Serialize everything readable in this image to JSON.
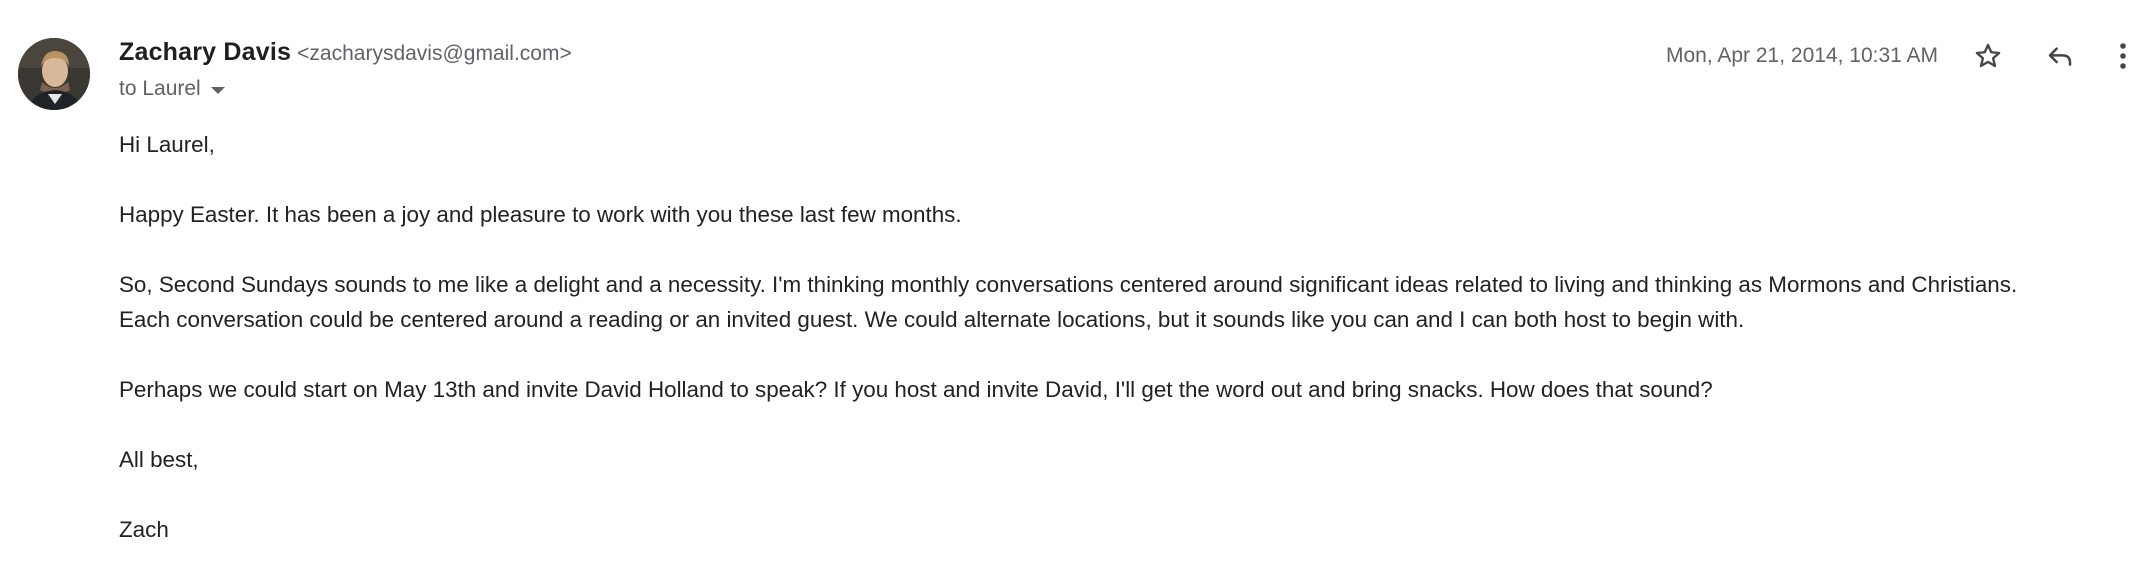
{
  "email": {
    "sender": {
      "name": "Zachary Davis",
      "email": "<zacharysdavis@gmail.com>"
    },
    "recipient_label": "to Laurel",
    "date": "Mon, Apr 21, 2014, 10:31 AM",
    "body": [
      {
        "lines": [
          "Hi Laurel,"
        ]
      },
      {
        "lines": [
          "Happy Easter. It has been a joy and pleasure to work with you these last few months."
        ]
      },
      {
        "lines": [
          "So, Second Sundays sounds to me like a delight and a necessity. I'm thinking monthly conversations centered around significant ideas related to living and thinking as Mormons and Christians.",
          "Each conversation could be centered around a reading or an invited guest. We could alternate locations, but it sounds like you can and I can both host to begin with."
        ]
      },
      {
        "lines": [
          "Perhaps we could start on May 13th and invite David Holland to speak? If you host and invite David, I'll get the word out and bring snacks. How does that sound?"
        ]
      },
      {
        "lines": [
          "All best,"
        ]
      },
      {
        "lines": [
          "Zach"
        ]
      }
    ]
  },
  "icons": {
    "star": "star-outline-icon",
    "reply": "reply-icon",
    "more": "more-vert-icon",
    "recipient_toggle": "caret-down-icon"
  },
  "colors": {
    "name": "#1f1f1f",
    "secondary_text": "#5f6368",
    "body_text": "#222222",
    "icon": "#444746"
  }
}
